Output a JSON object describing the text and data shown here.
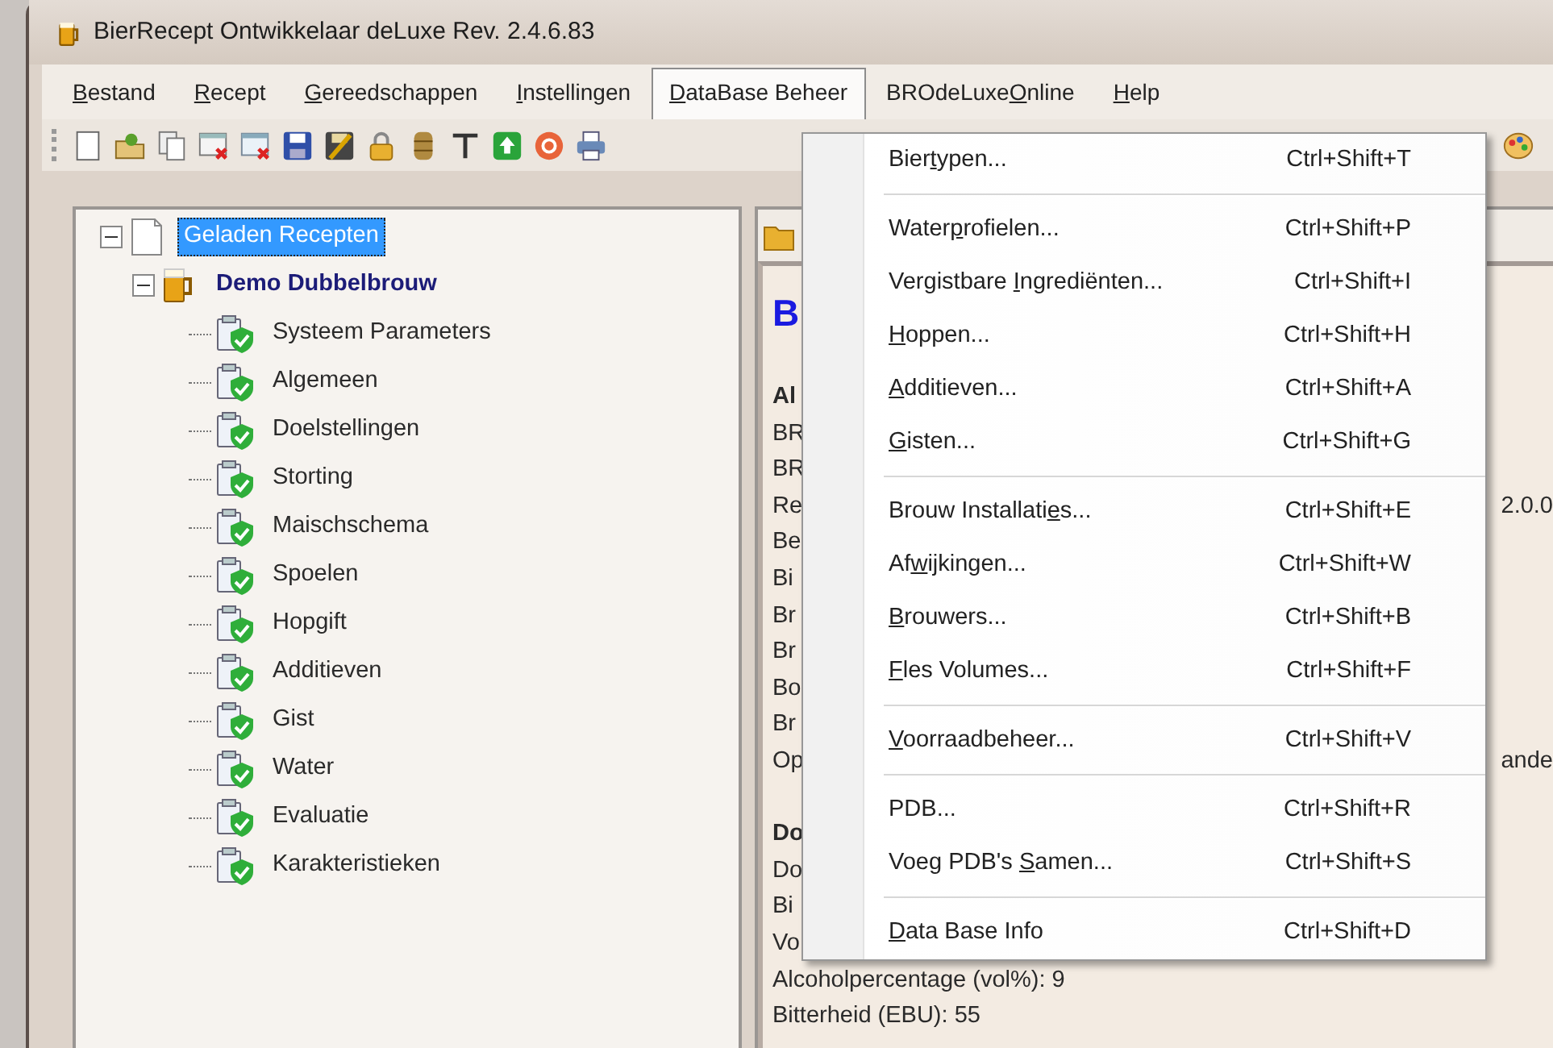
{
  "window": {
    "title": "BierRecept Ontwikkelaar deLuxe Rev. 2.4.6.83"
  },
  "menu_bar": [
    {
      "access_key": "B",
      "after": "estand",
      "selected": false
    },
    {
      "access_key": "R",
      "after": "ecept",
      "selected": false
    },
    {
      "access_key": "G",
      "after": "ereedschappen",
      "selected": false
    },
    {
      "access_key": "I",
      "after": "nstellingen",
      "selected": false
    },
    {
      "access_key": "D",
      "after": "ataBase Beheer",
      "selected": true
    },
    {
      "before": "BROdeLuxe",
      "access_key": "O",
      "after": "nline",
      "selected": false
    },
    {
      "access_key": "H",
      "after": "elp",
      "selected": false
    }
  ],
  "tree": {
    "label": "Geladen Recepten",
    "selected": true,
    "expanded": true,
    "children": [
      {
        "label": "Demo Dubbelbrouw",
        "selected": false,
        "expanded": true,
        "children": [
          {
            "label": "Systeem Parameters",
            "selected": false
          },
          {
            "label": "Algemeen",
            "selected": false
          },
          {
            "label": "Doelstellingen",
            "selected": false
          },
          {
            "label": "Storting",
            "selected": false
          },
          {
            "label": "Maischschema",
            "selected": false
          },
          {
            "label": "Spoelen",
            "selected": false
          },
          {
            "label": "Hopgift",
            "selected": false
          },
          {
            "label": "Additieven",
            "selected": false
          },
          {
            "label": "Gist",
            "selected": false
          },
          {
            "label": "Water",
            "selected": false
          },
          {
            "label": "Evaluatie",
            "selected": false
          },
          {
            "label": "Karakteristieken",
            "selected": false
          }
        ]
      }
    ]
  },
  "document": {
    "heading": "B",
    "lines": [
      {
        "kind": "section",
        "text": "Al"
      },
      {
        "kind": "line",
        "text": "BR"
      },
      {
        "kind": "line",
        "text": "BR"
      },
      {
        "kind": "line",
        "text": "Re",
        "tail": "2.0.0"
      },
      {
        "kind": "line",
        "text": "Be"
      },
      {
        "kind": "line",
        "text": "Bi"
      },
      {
        "kind": "line",
        "text": "Br"
      },
      {
        "kind": "line",
        "text": "Br"
      },
      {
        "kind": "line",
        "text": "Bo"
      },
      {
        "kind": "line",
        "text": "Br"
      },
      {
        "kind": "line",
        "text": "Op",
        "tail": "ande"
      },
      {
        "kind": "blank"
      },
      {
        "kind": "section",
        "text": "Do"
      },
      {
        "kind": "line",
        "text": "Do"
      },
      {
        "kind": "line",
        "text": "Bi"
      },
      {
        "kind": "line",
        "text": "Vo"
      },
      {
        "kind": "line",
        "text": "Alcoholpercentage (vol%): 9"
      },
      {
        "kind": "line",
        "text": "Bitterheid (EBU): 55"
      }
    ]
  },
  "dropdown": [
    {
      "kind": "item",
      "before": "Bier",
      "access_key": "t",
      "after": "ypen...",
      "shortcut": "Ctrl+Shift+T"
    },
    {
      "kind": "separator"
    },
    {
      "kind": "item",
      "before": "Water",
      "access_key": "p",
      "after": "rofielen...",
      "shortcut": "Ctrl+Shift+P"
    },
    {
      "kind": "item",
      "before": "Vergistbare ",
      "access_key": "I",
      "after": "ngrediënten...",
      "shortcut": "Ctrl+Shift+I"
    },
    {
      "kind": "item",
      "access_key": "H",
      "after": "oppen...",
      "shortcut": "Ctrl+Shift+H"
    },
    {
      "kind": "item",
      "access_key": "A",
      "after": "dditieven...",
      "shortcut": "Ctrl+Shift+A"
    },
    {
      "kind": "item",
      "access_key": "G",
      "after": "isten...",
      "shortcut": "Ctrl+Shift+G"
    },
    {
      "kind": "separator"
    },
    {
      "kind": "item",
      "before": "Brouw Installati",
      "access_key": "e",
      "after": "s...",
      "shortcut": "Ctrl+Shift+E"
    },
    {
      "kind": "item",
      "before": "Af",
      "access_key": "w",
      "after": "ijkingen...",
      "shortcut": "Ctrl+Shift+W"
    },
    {
      "kind": "item",
      "access_key": "B",
      "after": "rouwers...",
      "shortcut": "Ctrl+Shift+B"
    },
    {
      "kind": "item",
      "access_key": "F",
      "after": "les Volumes...",
      "shortcut": "Ctrl+Shift+F"
    },
    {
      "kind": "separator"
    },
    {
      "kind": "item",
      "access_key": "V",
      "after": "oorraadbeheer...",
      "shortcut": "Ctrl+Shift+V"
    },
    {
      "kind": "separator"
    },
    {
      "kind": "item",
      "before": "PDB...",
      "shortcut": "Ctrl+Shift+R"
    },
    {
      "kind": "item",
      "before": "Voeg PDB's ",
      "access_key": "S",
      "after": "amen...",
      "shortcut": "Ctrl+Shift+S"
    },
    {
      "kind": "separator"
    },
    {
      "kind": "item",
      "access_key": "D",
      "after": "ata Base Info",
      "shortcut": "Ctrl+Shift+D"
    }
  ]
}
